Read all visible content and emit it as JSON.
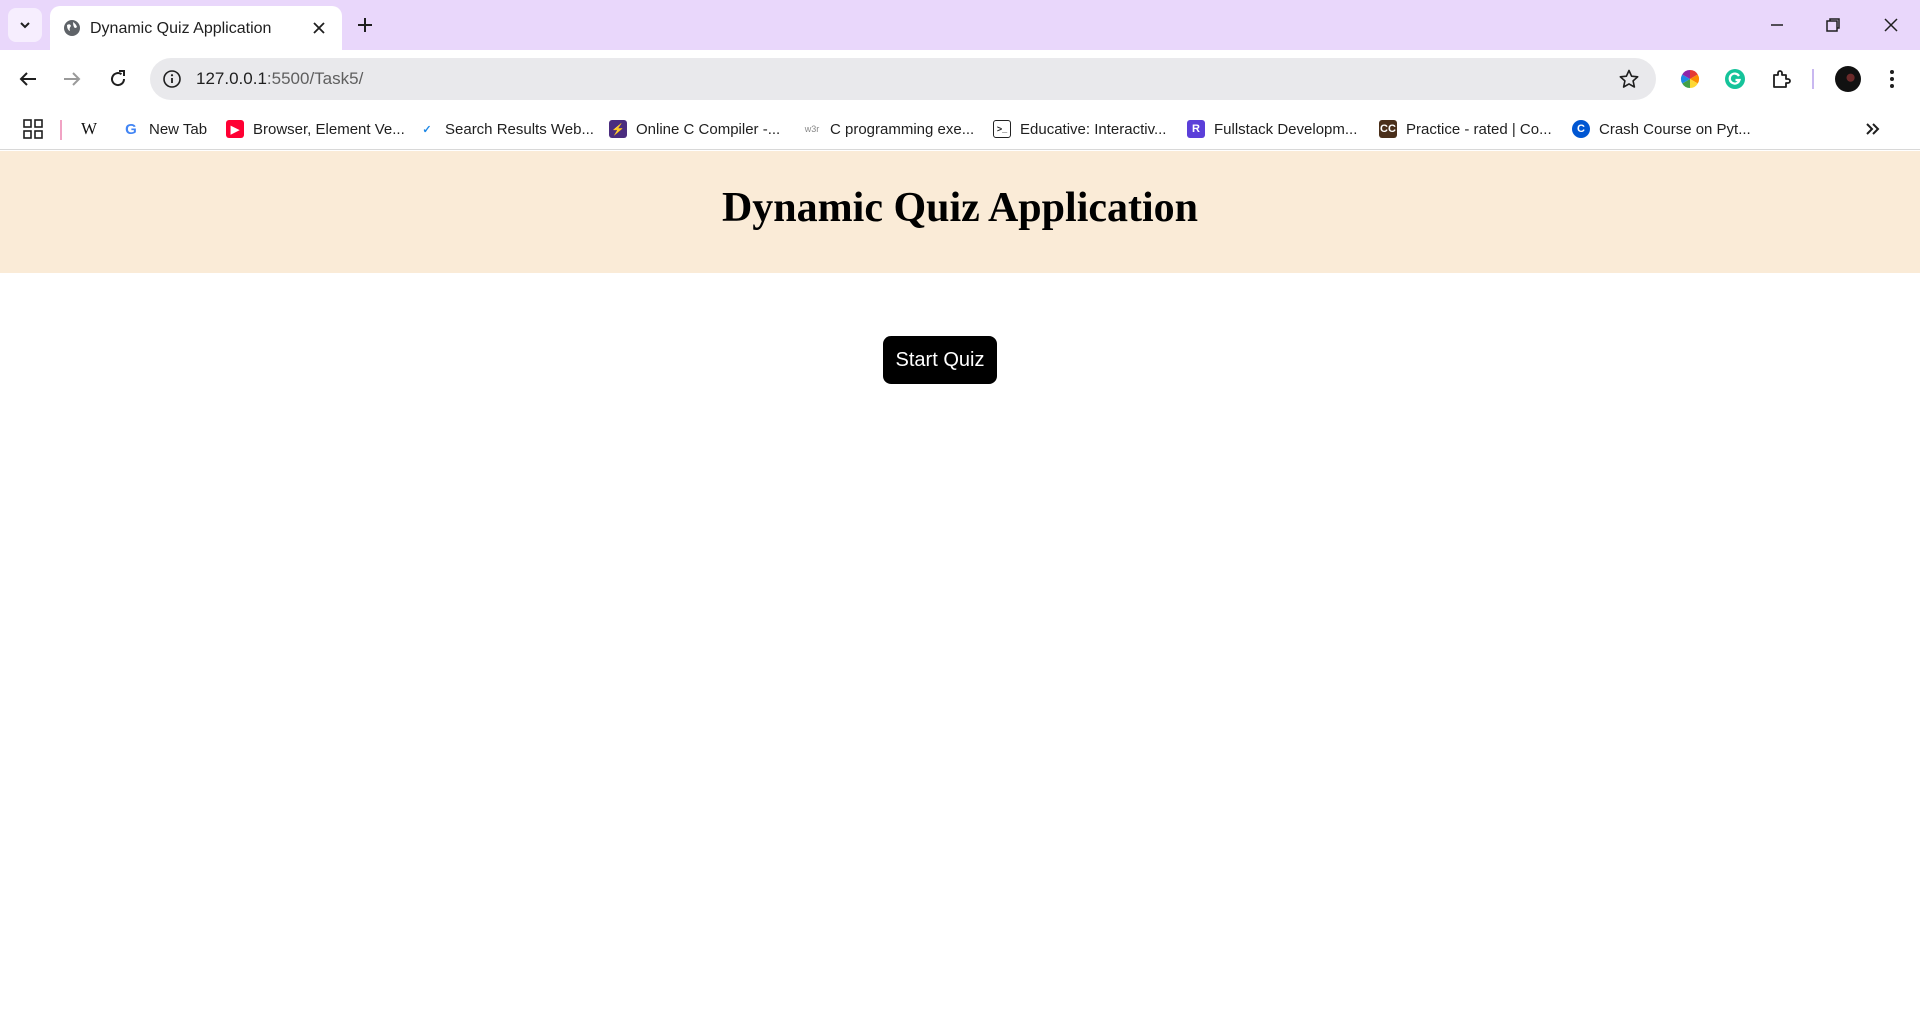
{
  "browser": {
    "tab": {
      "title": "Dynamic Quiz Application",
      "favicon": "globe-icon"
    },
    "address": {
      "host": "127.0.0.1",
      "path": ":5500/Task5/"
    },
    "bookmarks": [
      {
        "label": "",
        "icon": "wikipedia-icon",
        "glyph": "W",
        "color": "#ffffff",
        "fg": "#111111"
      },
      {
        "label": "New Tab",
        "icon": "google-icon",
        "glyph": "G",
        "color": "#ffffff",
        "fg": "#4285f4"
      },
      {
        "label": "Browser, Element Ve...",
        "icon": "youtube-icon",
        "glyph": "▶",
        "color": "#ff0033",
        "fg": "#ffffff"
      },
      {
        "label": "Search Results Web...",
        "icon": "check-icon",
        "glyph": "✓",
        "color": "#ffffff",
        "fg": "#1e88e5"
      },
      {
        "label": "Online C Compiler -...",
        "icon": "bolt-icon",
        "glyph": "⚡",
        "color": "#4b2d7f",
        "fg": "#ffffff"
      },
      {
        "label": "C programming exe...",
        "icon": "w3r-icon",
        "glyph": "w3r",
        "color": "#ffffff",
        "fg": "#888888"
      },
      {
        "label": "Educative: Interactiv...",
        "icon": "terminal-icon",
        "glyph": ">_",
        "color": "#ffffff",
        "fg": "#222222"
      },
      {
        "label": "Fullstack Developm...",
        "icon": "r-icon",
        "glyph": "R",
        "color": "#5b3fd9",
        "fg": "#ffffff"
      },
      {
        "label": "Practice - rated | Co...",
        "icon": "cc-icon",
        "glyph": "CC",
        "color": "#4a2f1a",
        "fg": "#ffffff"
      },
      {
        "label": "Crash Course on Pyt...",
        "icon": "coursera-icon",
        "glyph": "C",
        "color": "#0056d2",
        "fg": "#ffffff"
      }
    ]
  },
  "page": {
    "title": "Dynamic Quiz Application",
    "start_button": "Start Quiz"
  },
  "colors": {
    "tabstrip": "#e9d7fb",
    "header_bg": "#faebd7",
    "button_bg": "#000000"
  }
}
